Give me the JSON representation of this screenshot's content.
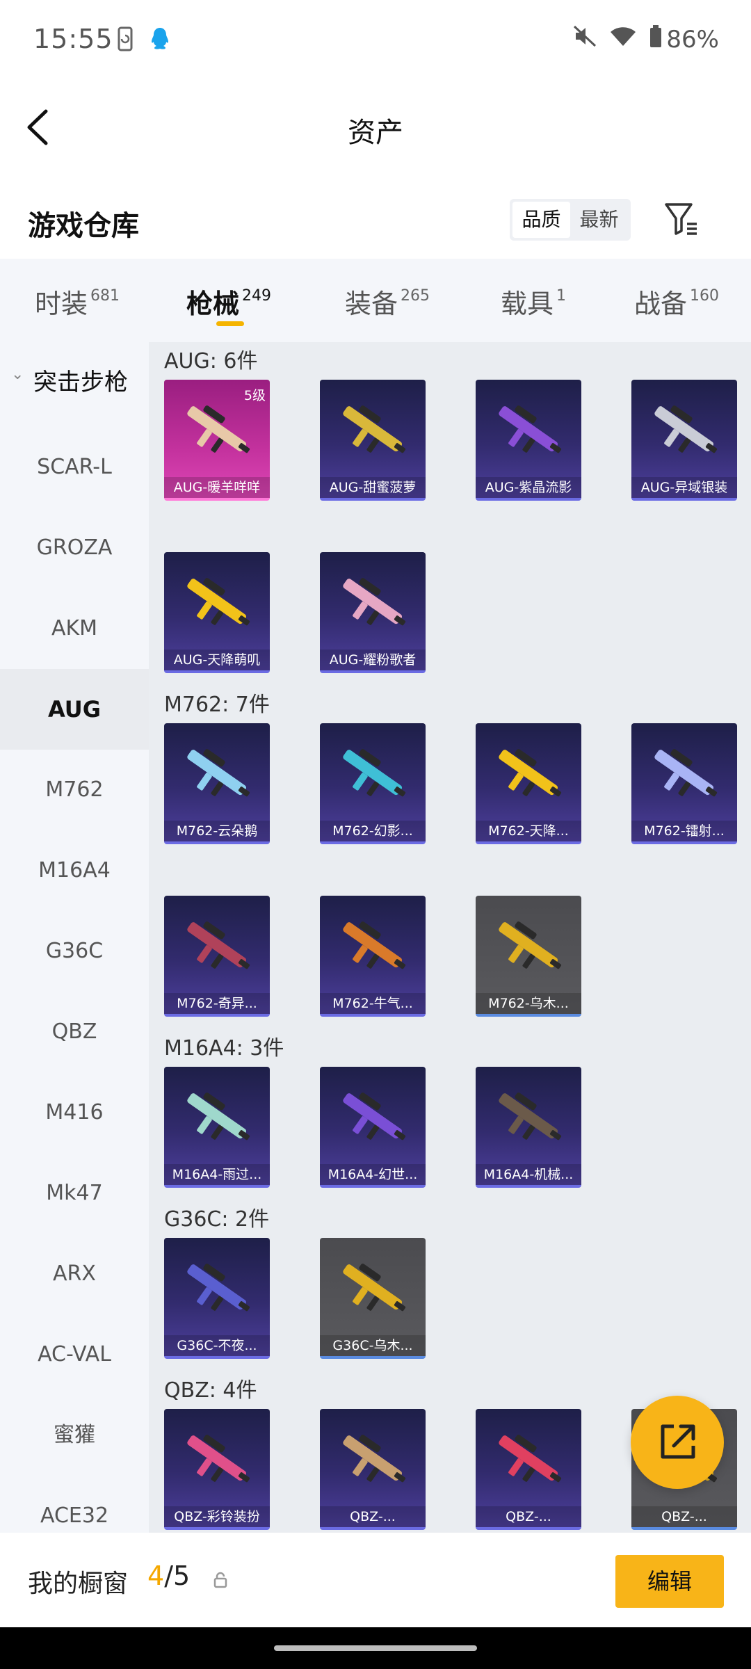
{
  "status_bar": {
    "time": "15:55",
    "battery": "86%"
  },
  "header": {
    "title": "资产"
  },
  "warehouse": {
    "title": "游戏仓库",
    "sort_options": [
      "品质",
      "最新"
    ],
    "sort_active": "品质"
  },
  "tabs": [
    {
      "label": "时装",
      "count": "681"
    },
    {
      "label": "枪械",
      "count": "249",
      "active": true
    },
    {
      "label": "装备",
      "count": "265"
    },
    {
      "label": "载具",
      "count": "1"
    },
    {
      "label": "战备",
      "count": "160"
    }
  ],
  "sidebar": {
    "group": "突击步枪",
    "items": [
      "SCAR-L",
      "GROZA",
      "AKM",
      "AUG",
      "M762",
      "M16A4",
      "G36C",
      "QBZ",
      "M416",
      "Mk47",
      "ARX",
      "AC-VAL",
      "蜜獾",
      "ACE32"
    ],
    "active": "AUG"
  },
  "sections": [
    {
      "title": "AUG: 6件",
      "items": [
        {
          "name": "AUG-暖羊咩咩",
          "level": "5级",
          "style": "pink",
          "color": "#e8c9a8"
        },
        {
          "name": "AUG-甜蜜菠萝",
          "style": "purple",
          "color": "#d9b83a"
        },
        {
          "name": "AUG-紫晶流影",
          "style": "purple",
          "color": "#8a4fd6"
        },
        {
          "name": "AUG-异域银装",
          "style": "purple",
          "color": "#c9ccd6"
        },
        {
          "name": "AUG-天降萌叽",
          "style": "purple",
          "color": "#f2c21a"
        },
        {
          "name": "AUG-耀粉歌者",
          "style": "purple",
          "color": "#e6a7c4"
        }
      ]
    },
    {
      "title": "M762: 7件",
      "items": [
        {
          "name": "M762-云朵鹅",
          "style": "purple",
          "color": "#8fd0f0"
        },
        {
          "name": "M762-幻影...",
          "style": "purple",
          "color": "#3fbfd6"
        },
        {
          "name": "M762-天降...",
          "style": "purple",
          "color": "#f2c21a"
        },
        {
          "name": "M762-镭射...",
          "style": "purple",
          "color": "#a9b4f5"
        },
        {
          "name": "M762-奇异...",
          "style": "purple",
          "color": "#b0425a"
        },
        {
          "name": "M762-牛气...",
          "style": "purple",
          "color": "#d97a2a"
        },
        {
          "name": "M762-乌木...",
          "style": "grey",
          "color": "#e0b020"
        }
      ]
    },
    {
      "title": "M16A4: 3件",
      "items": [
        {
          "name": "M16A4-雨过...",
          "style": "purple",
          "color": "#9fd8cc"
        },
        {
          "name": "M16A4-幻世...",
          "style": "purple",
          "color": "#7a4fd6"
        },
        {
          "name": "M16A4-机械...",
          "style": "purple",
          "color": "#6b5a4a"
        }
      ]
    },
    {
      "title": "G36C: 2件",
      "items": [
        {
          "name": "G36C-不夜...",
          "style": "purple",
          "color": "#5a5fd0"
        },
        {
          "name": "G36C-乌木...",
          "style": "grey",
          "color": "#e0b020"
        }
      ]
    },
    {
      "title": "QBZ: 4件",
      "items": [
        {
          "name": "QBZ-彩铃装扮",
          "style": "purple",
          "color": "#e0508a"
        },
        {
          "name": "QBZ-...",
          "style": "purple",
          "color": "#c8a070"
        },
        {
          "name": "QBZ-...",
          "style": "purple",
          "color": "#e04060"
        },
        {
          "name": "QBZ-...",
          "style": "grey",
          "color": "#e0b020"
        }
      ]
    }
  ],
  "bottom_bar": {
    "label": "我的橱窗",
    "current": "4",
    "total": "/5",
    "edit_label": "编辑"
  }
}
